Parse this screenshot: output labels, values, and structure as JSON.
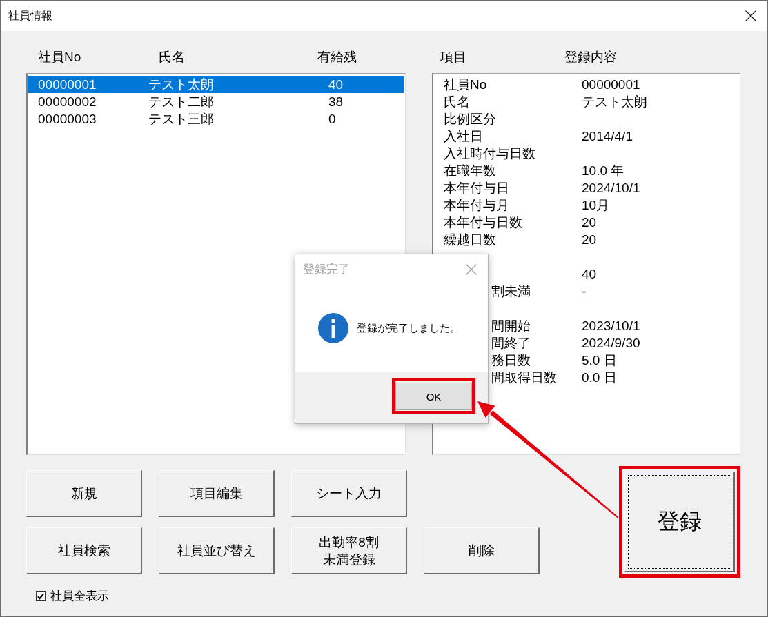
{
  "window": {
    "title": "社員情報"
  },
  "employee_list": {
    "columns": [
      "社員No",
      "氏名",
      "有給残"
    ],
    "rows": [
      {
        "employee_no": "00000001",
        "name": "テスト太朗",
        "paid_leave_balance": "40",
        "selected": true
      },
      {
        "employee_no": "00000002",
        "name": "テスト二郎",
        "paid_leave_balance": "38",
        "selected": false
      },
      {
        "employee_no": "00000003",
        "name": "テスト三郎",
        "paid_leave_balance": "0",
        "selected": false
      }
    ]
  },
  "detail_list": {
    "columns": [
      "項目",
      "登録内容"
    ],
    "rows": [
      {
        "label": "社員No",
        "value": "00000001"
      },
      {
        "label": "氏名",
        "value": "テスト太朗"
      },
      {
        "label": "比例区分"
      },
      {
        "label": "入社日",
        "value": "2014/4/1"
      },
      {
        "label": "入社時付与日数"
      },
      {
        "label": "在職年数",
        "value": "10.0 年"
      },
      {
        "label": "本年付与日",
        "value": "2024/10/1"
      },
      {
        "label": "本年付与月",
        "value": "10月"
      },
      {
        "label": "本年付与日数",
        "value": "20"
      },
      {
        "label": "繰越日数",
        "value": "20"
      },
      {},
      {
        "value": "40"
      },
      {
        "label_end": "割未満",
        "value": "-"
      },
      {},
      {
        "label_end": "間開始",
        "value": "2023/10/1"
      },
      {
        "label_end": "間終了",
        "value": "2024/9/30"
      },
      {
        "label_end": "務日数",
        "value": "5.0 日"
      },
      {
        "label_end": "間取得日数",
        "value": "0.0 日"
      }
    ]
  },
  "buttons": [
    [
      {
        "label": "新規"
      },
      {
        "label": "項目編集"
      },
      {
        "label": "シート入力"
      }
    ],
    [
      {
        "label": "社員検索"
      },
      {
        "label": "社員並び替え"
      },
      {
        "label": "出勤率8割未満登録"
      },
      {
        "label": "削除"
      }
    ]
  ],
  "register_button": {
    "label": "登録",
    "highlighted": true
  },
  "show_all": {
    "label": "社員全表示",
    "checked": true
  },
  "dialog": {
    "title": "登録完了",
    "message": "登録が完了しました。",
    "ok_button": {
      "label": "OK",
      "highlighted": true
    }
  }
}
